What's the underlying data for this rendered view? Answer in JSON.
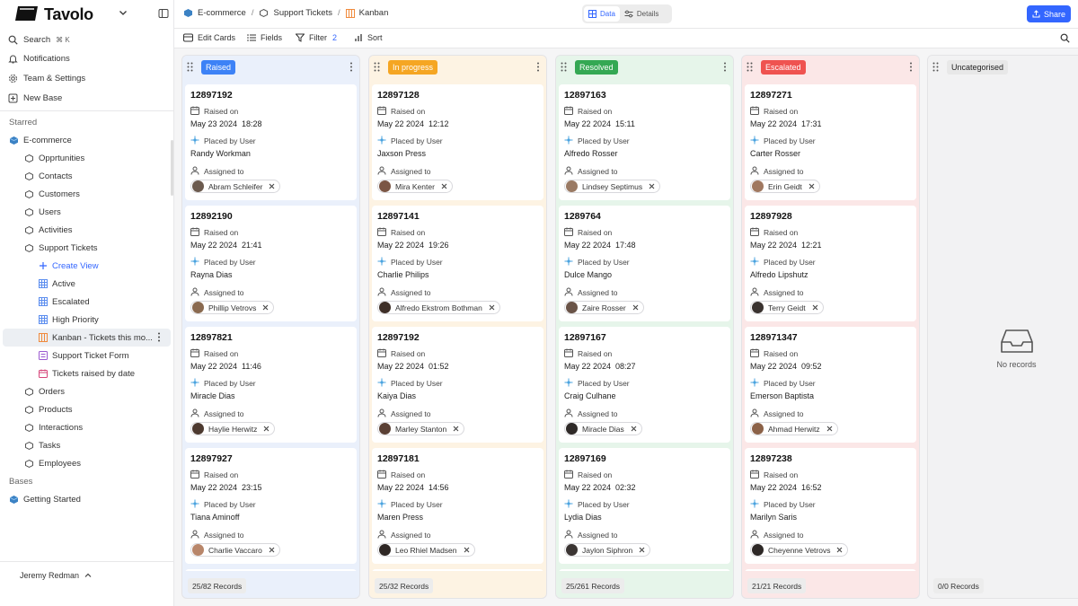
{
  "app": {
    "name": "Tavolo",
    "user": "Jeremy Redman"
  },
  "sidebar": {
    "search_label": "Search",
    "search_shortcut": "⌘ K",
    "notifications_label": "Notifications",
    "team_label": "Team & Settings",
    "new_base_label": "New Base",
    "starred_label": "Starred",
    "base_name": "E-commerce",
    "tables": [
      {
        "label": "Opprtunities"
      },
      {
        "label": "Contacts"
      },
      {
        "label": "Customers"
      },
      {
        "label": "Users"
      },
      {
        "label": "Activities"
      },
      {
        "label": "Support Tickets"
      }
    ],
    "views": [
      {
        "label": "Create View"
      },
      {
        "label": "Active"
      },
      {
        "label": "Escalated"
      },
      {
        "label": "High Priority"
      },
      {
        "label": "Kanban - Tickets this mo..."
      },
      {
        "label": "Support Ticket Form"
      },
      {
        "label": "Tickets raised by date"
      }
    ],
    "tables_after": [
      {
        "label": "Orders"
      },
      {
        "label": "Products"
      },
      {
        "label": "Interactions"
      },
      {
        "label": "Tasks"
      },
      {
        "label": "Employees"
      }
    ],
    "bases_label": "Bases",
    "bases": [
      {
        "label": "Getting Started"
      }
    ]
  },
  "header": {
    "crumb_base": "E-commerce",
    "crumb_table": "Support Tickets",
    "crumb_view": "Kanban",
    "seg_data": "Data",
    "seg_details": "Details",
    "share_label": "Share"
  },
  "toolbar": {
    "edit_cards": "Edit Cards",
    "fields": "Fields",
    "filter": "Filter",
    "filter_count": "2",
    "sort": "Sort"
  },
  "field_labels": {
    "raised": "Raised on",
    "placed": "Placed by User",
    "assigned": "Assigned to"
  },
  "columns": [
    {
      "label": "Raised",
      "badge_bg": "#3d82f6",
      "badge_fg": "#ffffff",
      "tint": "#eaf0fb",
      "records": "25/82 Records",
      "cards": [
        {
          "id": "12897192",
          "date": "May 23 2024",
          "time": "18:28",
          "user": "Randy Workman",
          "assignee": "Abram Schleifer",
          "avatar": "#6b5a4e"
        },
        {
          "id": "12892190",
          "date": "May 22 2024",
          "time": "21:41",
          "user": "Rayna Dias",
          "assignee": "Phillip Vetrovs",
          "avatar": "#8a6a50"
        },
        {
          "id": "12897821",
          "date": "May 22 2024",
          "time": "11:46",
          "user": "Miracle Dias",
          "assignee": "Haylie Herwitz",
          "avatar": "#4d3a30"
        },
        {
          "id": "12897927",
          "date": "May 22 2024",
          "time": "23:15",
          "user": "Tiana Aminoff",
          "assignee": "Charlie Vaccaro",
          "avatar": "#b8866a"
        }
      ]
    },
    {
      "label": "In progress",
      "badge_bg": "#f5a623",
      "badge_fg": "#ffffff",
      "tint": "#fdf3e3",
      "records": "25/32 Records",
      "cards": [
        {
          "id": "12897128",
          "date": "May 22 2024",
          "time": "12:12",
          "user": "Jaxson Press",
          "assignee": "Mira Kenter",
          "avatar": "#7b5645"
        },
        {
          "id": "12897141",
          "date": "May 22 2024",
          "time": "19:26",
          "user": "Charlie Philips",
          "assignee": "Alfredo Ekstrom Bothman",
          "avatar": "#3e2f28"
        },
        {
          "id": "12897192",
          "date": "May 22 2024",
          "time": "01:52",
          "user": "Kaiya Dias",
          "assignee": "Marley Stanton",
          "avatar": "#5a4034"
        },
        {
          "id": "12897181",
          "date": "May 22 2024",
          "time": "14:56",
          "user": "Maren Press",
          "assignee": "Leo Rhiel Madsen",
          "avatar": "#2e2724"
        }
      ]
    },
    {
      "label": "Resolved",
      "badge_bg": "#34a853",
      "badge_fg": "#ffffff",
      "tint": "#e6f5ea",
      "records": "25/261 Records",
      "cards": [
        {
          "id": "12897163",
          "date": "May 22 2024",
          "time": "15:11",
          "user": "Alfredo Rosser",
          "assignee": "Lindsey Septimus",
          "avatar": "#9a7a64"
        },
        {
          "id": "1289764",
          "date": "May 22 2024",
          "time": "17:48",
          "user": "Dulce Mango",
          "assignee": "Zaire Rosser",
          "avatar": "#6a5448"
        },
        {
          "id": "12897167",
          "date": "May 22 2024",
          "time": "08:27",
          "user": "Craig Culhane",
          "assignee": "Miracle Dias",
          "avatar": "#2f2a28"
        },
        {
          "id": "12897169",
          "date": "May 22 2024",
          "time": "02:32",
          "user": "Lydia Dias",
          "assignee": "Jaylon Siphron",
          "avatar": "#3b3533"
        }
      ]
    },
    {
      "label": "Escalated",
      "badge_bg": "#ef5350",
      "badge_fg": "#ffffff",
      "tint": "#fbe7e7",
      "records": "21/21 Records",
      "cards": [
        {
          "id": "12897271",
          "date": "May 22 2024",
          "time": "17:31",
          "user": "Carter Rosser",
          "assignee": "Erin Geidt",
          "avatar": "#a07860"
        },
        {
          "id": "12897928",
          "date": "May 22 2024",
          "time": "12:21",
          "user": "Alfredo Lipshutz",
          "assignee": "Terry Geidt",
          "avatar": "#3a3330"
        },
        {
          "id": "128971347",
          "date": "May 22 2024",
          "time": "09:52",
          "user": "Emerson Baptista",
          "assignee": "Ahmad Herwitz",
          "avatar": "#8c6248"
        },
        {
          "id": "12897238",
          "date": "May 22 2024",
          "time": "16:52",
          "user": "Marilyn Saris",
          "assignee": "Cheyenne Vetrovs",
          "avatar": "#2d2826"
        }
      ]
    },
    {
      "label": "Uncategorised",
      "badge_bg": "#e8e8e8",
      "badge_fg": "#222222",
      "tint": "#f2f2f3",
      "records": "0/0 Records",
      "cards": [],
      "empty_text": "No records"
    }
  ]
}
